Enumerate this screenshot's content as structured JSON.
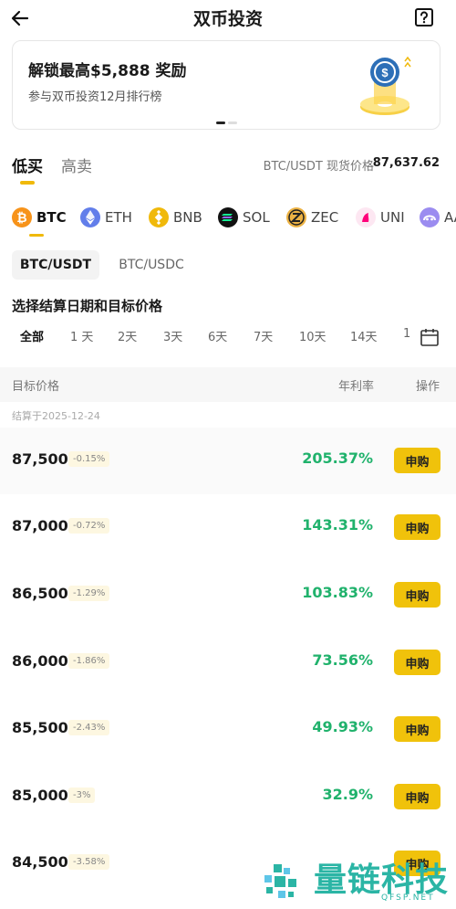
{
  "header": {
    "title": "双币投资",
    "back_icon": "arrow-left-icon",
    "help_icon": "help-icon"
  },
  "banner": {
    "title": "解锁最高$5,888 奖励",
    "subtitle": "参与双币投资12月排行榜",
    "art_icon": "usdc-coin-icon"
  },
  "tabs": [
    {
      "label": "低买",
      "active": true
    },
    {
      "label": "高卖",
      "active": false
    }
  ],
  "spot": {
    "label": "BTC/USDT 现货价格",
    "value": "87,637.62"
  },
  "coins": [
    {
      "symbol": "BTC",
      "icon": "btc-icon",
      "color": "#f7931a",
      "active": true
    },
    {
      "symbol": "ETH",
      "icon": "eth-icon",
      "color": "#627eea",
      "active": false
    },
    {
      "symbol": "BNB",
      "icon": "bnb-icon",
      "color": "#f0b90b",
      "active": false
    },
    {
      "symbol": "SOL",
      "icon": "sol-icon",
      "color": "#111111",
      "active": false
    },
    {
      "symbol": "ZEC",
      "icon": "zec-icon",
      "color": "#ecb244",
      "active": false
    },
    {
      "symbol": "UNI",
      "icon": "uni-icon",
      "color": "#ff007a",
      "active": false
    },
    {
      "symbol": "AAVE",
      "icon": "aave-icon",
      "color": "#9b8cf0",
      "active": false
    }
  ],
  "pairs": [
    {
      "label": "BTC/USDT",
      "active": true
    },
    {
      "label": "BTC/USDC",
      "active": false
    }
  ],
  "section_title": "选择结算日期和目标价格",
  "dates": [
    "全部",
    "1 天",
    "2天",
    "3天",
    "6天",
    "7天",
    "10天",
    "14天",
    "1"
  ],
  "table": {
    "headers": {
      "price": "目标价格",
      "rate": "年利率",
      "op": "操作"
    },
    "settle_label": "结算于2025-12-24",
    "rows": [
      {
        "price": "87,500",
        "pct": "-0.15%",
        "rate": "205.37%",
        "action": "申购"
      },
      {
        "price": "87,000",
        "pct": "-0.72%",
        "rate": "143.31%",
        "action": "申购"
      },
      {
        "price": "86,500",
        "pct": "-1.29%",
        "rate": "103.83%",
        "action": "申购"
      },
      {
        "price": "86,000",
        "pct": "-1.86%",
        "rate": "73.56%",
        "action": "申购"
      },
      {
        "price": "85,500",
        "pct": "-2.43%",
        "rate": "49.93%",
        "action": "申购"
      },
      {
        "price": "85,000",
        "pct": "-3%",
        "rate": "32.9%",
        "action": "申购"
      },
      {
        "price": "84,500",
        "pct": "-3.58%",
        "rate": "",
        "action": "申购"
      }
    ]
  },
  "watermark": {
    "text": "量链科技",
    "sub": "QFSP.NET"
  },
  "colors": {
    "accent": "#f0b90b",
    "positive": "#20b26c",
    "button": "#f0c20b"
  }
}
